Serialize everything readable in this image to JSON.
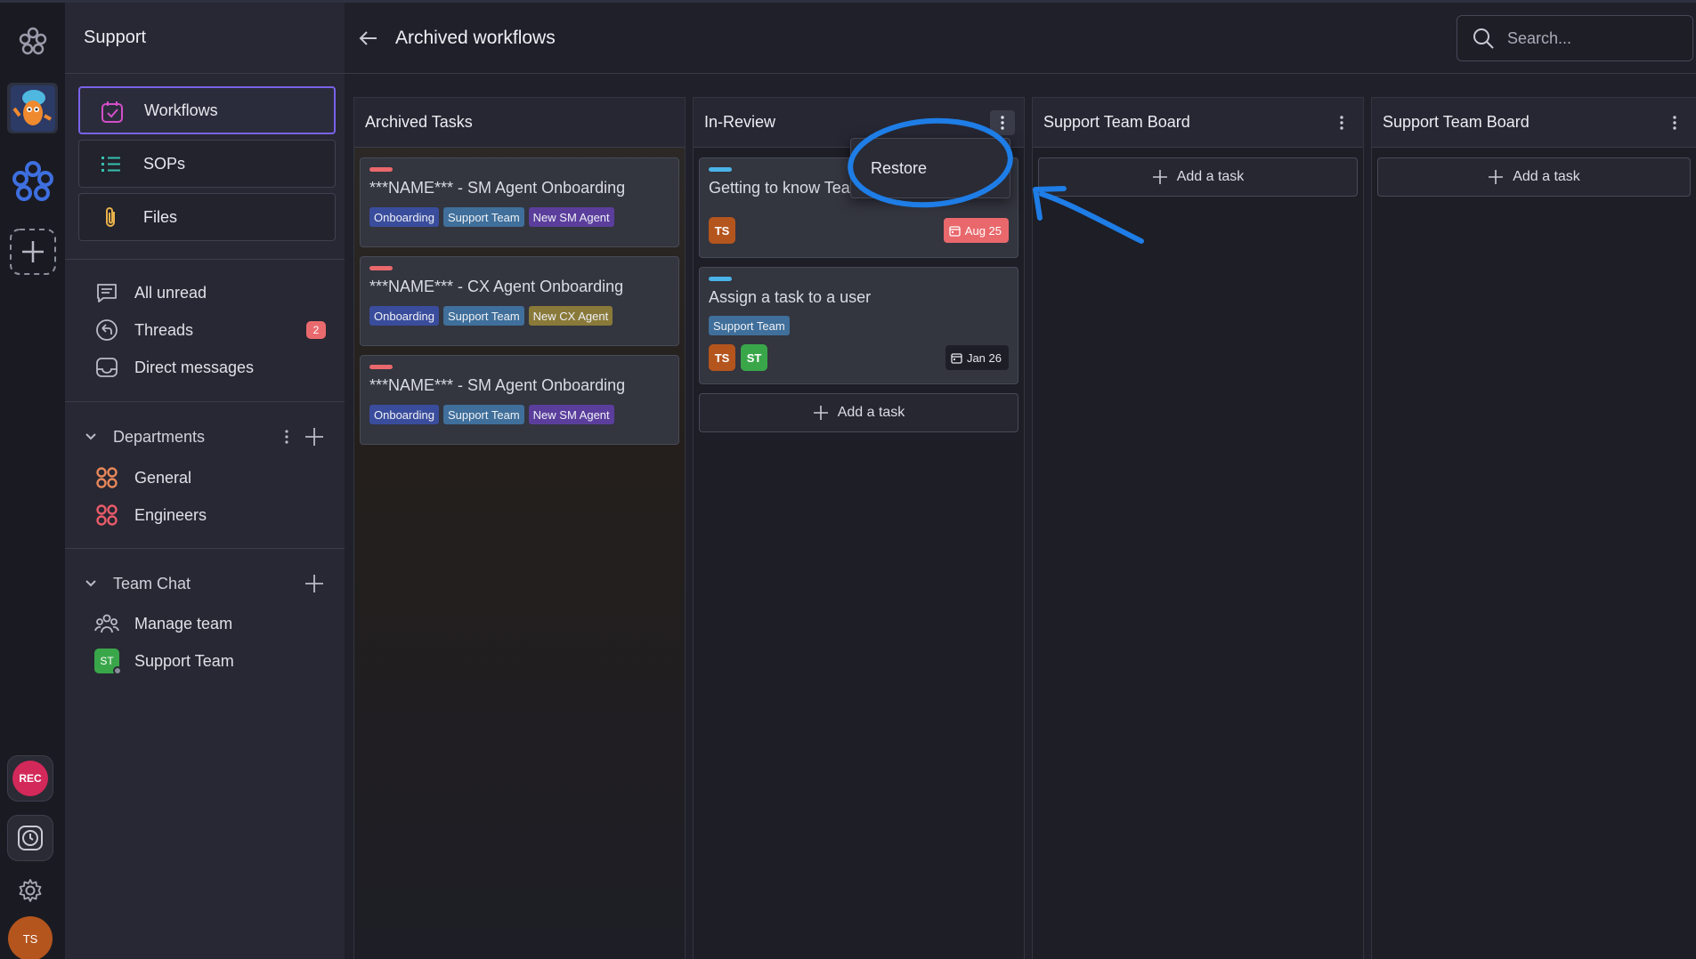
{
  "rail": {
    "icons": [
      "flower-logo-icon",
      "mascot-avatar",
      "workspace-flower-icon",
      "add-workspace-icon"
    ],
    "rec_label": "REC",
    "user_initials": "TS"
  },
  "sidebar": {
    "title": "Support",
    "nav": [
      {
        "label": "Workflows",
        "icon": "workflow-check-icon",
        "active": true
      },
      {
        "label": "SOPs",
        "icon": "list-icon"
      },
      {
        "label": "Files",
        "icon": "paperclip-icon"
      }
    ],
    "items": [
      {
        "label": "All unread",
        "icon": "message-icon"
      },
      {
        "label": "Threads",
        "icon": "threads-icon",
        "badge": "2"
      },
      {
        "label": "Direct messages",
        "icon": "inbox-icon"
      }
    ],
    "departments": {
      "title": "Departments",
      "items": [
        {
          "label": "General",
          "color": "#e8875a"
        },
        {
          "label": "Engineers",
          "color": "#e95b6a"
        }
      ]
    },
    "team_chat": {
      "title": "Team Chat",
      "items": [
        {
          "label": "Manage team",
          "icon": "team-icon"
        },
        {
          "label": "Support Team",
          "avatar": "ST"
        }
      ]
    }
  },
  "header": {
    "title": "Archived workflows",
    "search_placeholder": "Search..."
  },
  "columns": [
    {
      "title": "Archived Tasks",
      "cards": [
        {
          "title": "***NAME*** - SM Agent Onboarding",
          "tags": [
            "Onboarding",
            "Support Team",
            "New SM Agent"
          ]
        },
        {
          "title": "***NAME*** - CX Agent Onboarding",
          "tags": [
            "Onboarding",
            "Support Team",
            "New CX Agent"
          ]
        },
        {
          "title": "***NAME*** - SM Agent Onboarding",
          "tags": [
            "Onboarding",
            "Support Team",
            "New SM Agent"
          ]
        }
      ]
    },
    {
      "title": "In-Review",
      "cards": [
        {
          "title": "Getting to know Tea",
          "avatars": [
            "TS"
          ],
          "date": "Aug 25"
        },
        {
          "title": "Assign a task to a user",
          "tags": [
            "Support Team"
          ],
          "avatars": [
            "TS",
            "ST"
          ],
          "date": "Jan 26"
        }
      ],
      "add_label": "Add a task"
    },
    {
      "title": "Support Team Board",
      "add_label": "Add a task"
    },
    {
      "title": "Support Team Board",
      "add_label": "Add a task"
    }
  ],
  "context_menu": {
    "items": [
      "Restore"
    ]
  },
  "colors": {
    "accent": "#7a62e8",
    "stripe_red": "#e9686c",
    "stripe_blue": "#4ab3e8",
    "tag_onboarding": "#3a4d9c",
    "tag_support": "#3f6f9a",
    "tag_sm_agent": "#5b3e9c",
    "tag_cx_agent": "#8a7a3a",
    "date_overdue": "#e9686c",
    "annotation": "#1e7de6"
  }
}
